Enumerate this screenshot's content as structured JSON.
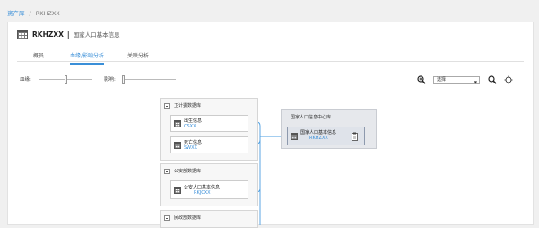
{
  "breadcrumb": {
    "root": "资产库",
    "separator": "/",
    "current": "RKHZXX"
  },
  "header": {
    "code": "RKHZXX",
    "divider": "|",
    "name": "国家人口基本信息"
  },
  "tabs": [
    {
      "label": "概员",
      "active": false
    },
    {
      "label": "血缘/影响分析",
      "active": true
    },
    {
      "label": "关联分析",
      "active": false
    }
  ],
  "controls": {
    "lineage_label": "血缘:",
    "impact_label": "影响:",
    "select_value": "选择",
    "lineage_level": 0.5,
    "impact_level": 0
  },
  "groups": [
    {
      "title": "卫计委数据库",
      "nodes": [
        {
          "name": "出生信息",
          "code": "CSXX"
        },
        {
          "name": "死亡信息",
          "code": "SWXX"
        }
      ]
    },
    {
      "title": "公安部数据库",
      "nodes": [
        {
          "name": "公安人口基本信息",
          "code": "RKJCXX"
        }
      ]
    },
    {
      "title": "民政部数据库",
      "nodes": []
    }
  ],
  "target": {
    "title": "国家人口信息中心库",
    "node": {
      "name": "国家人口基本信息",
      "code": "RKHZXX"
    }
  },
  "colors": {
    "link": "#3a8fd8",
    "edge": "#4a9de0"
  }
}
